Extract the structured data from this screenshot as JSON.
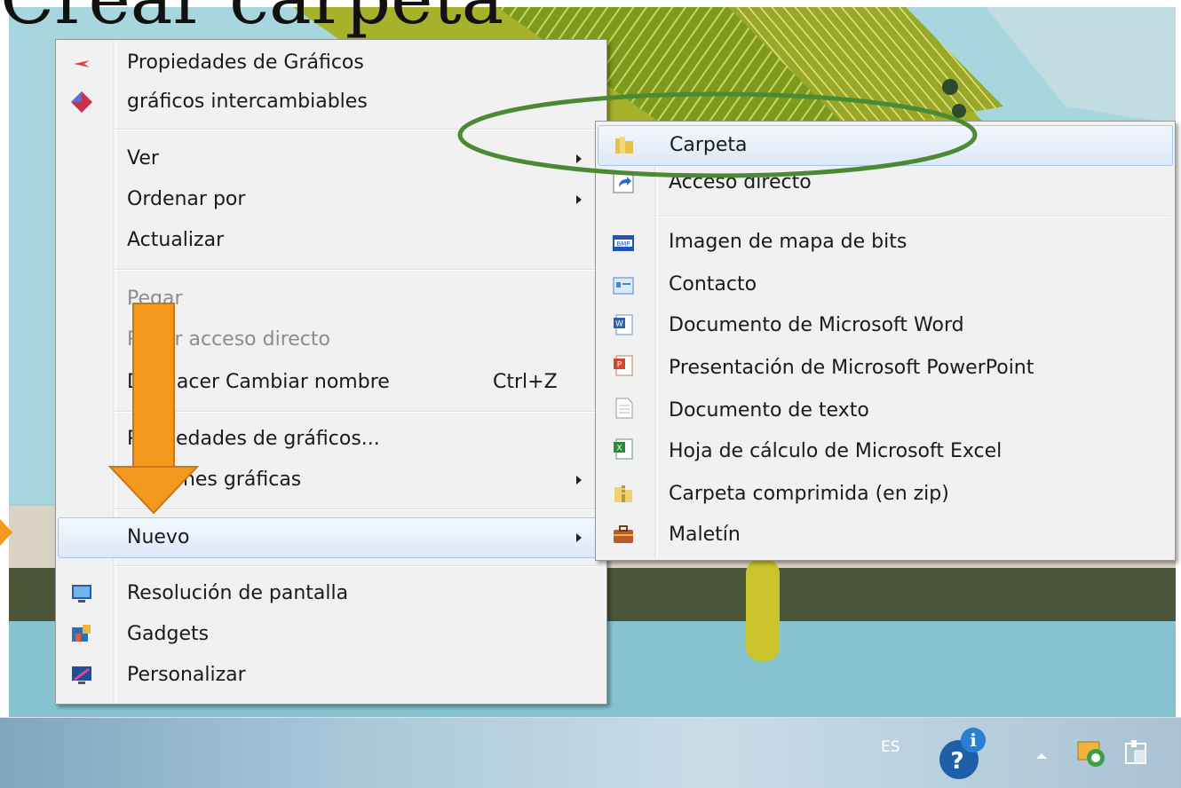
{
  "title_partial": "Crear carpeta",
  "context_menu": {
    "items": [
      {
        "label": "Propiedades de Gráficos",
        "icon": "graphics-properties-icon"
      },
      {
        "label": "gráficos intercambiables",
        "icon": "switchable-graphics-icon"
      },
      {
        "label": "Ver",
        "submenu": true
      },
      {
        "label": "Ordenar por",
        "submenu": true
      },
      {
        "label": "Actualizar"
      },
      {
        "label": "Pegar",
        "disabled": true
      },
      {
        "label": "Pegar acceso directo",
        "disabled": true
      },
      {
        "label": "Deshacer Cambiar nombre",
        "shortcut": "Ctrl+Z"
      },
      {
        "label": "Propiedades de gráficos..."
      },
      {
        "label": "Opciones gráficas",
        "submenu": true
      },
      {
        "label": "Nuevo",
        "submenu": true,
        "highlighted": true
      },
      {
        "label": "Resolución de pantalla",
        "icon": "screen-resolution-icon"
      },
      {
        "label": "Gadgets",
        "icon": "gadgets-icon"
      },
      {
        "label": "Personalizar",
        "icon": "personalize-icon"
      }
    ]
  },
  "submenu_nuevo": {
    "items": [
      {
        "label": "Carpeta",
        "icon": "folder-icon",
        "highlighted": true
      },
      {
        "label": "Acceso directo",
        "icon": "shortcut-icon"
      },
      {
        "label": "Imagen de mapa de bits",
        "icon": "bitmap-icon"
      },
      {
        "label": "Contacto",
        "icon": "contact-icon"
      },
      {
        "label": "Documento de Microsoft Word",
        "icon": "word-document-icon"
      },
      {
        "label": "Presentación de Microsoft PowerPoint",
        "icon": "powerpoint-icon"
      },
      {
        "label": "Documento de texto",
        "icon": "text-document-icon"
      },
      {
        "label": "Hoja de cálculo de Microsoft Excel",
        "icon": "excel-icon"
      },
      {
        "label": "Carpeta comprimida (en zip)",
        "icon": "zip-folder-icon"
      },
      {
        "label": "Maletín",
        "icon": "briefcase-icon"
      }
    ]
  },
  "taskbar": {
    "language": "ES",
    "tray_icons": [
      "help-icon",
      "show-hidden-icons-arrow",
      "network-icon",
      "action-center-icon"
    ]
  },
  "annotations": {
    "circle_color": "#4a8a34",
    "arrow_color": "#f39a1e"
  }
}
